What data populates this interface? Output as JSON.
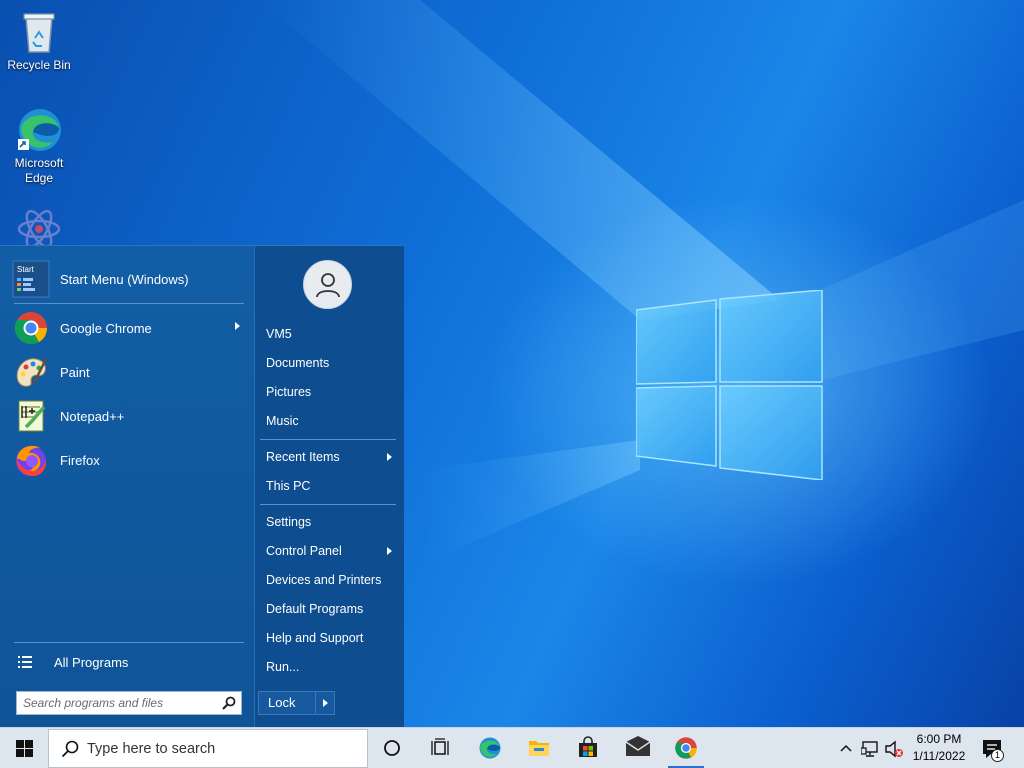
{
  "desktop": {
    "icons": [
      {
        "label": "Recycle Bin",
        "icon": "recycle-bin-icon"
      },
      {
        "label": "Microsoft Edge",
        "icon": "edge-icon"
      },
      {
        "label": "",
        "icon": "partial-app-icon"
      }
    ]
  },
  "start_menu": {
    "programs": [
      {
        "label": "Start Menu (Windows)",
        "icon": "start-menu-icon",
        "icon_text": "Start"
      },
      {
        "label": "Google Chrome",
        "icon": "chrome-icon",
        "has_submenu": true
      },
      {
        "label": "Paint",
        "icon": "paint-icon"
      },
      {
        "label": "Notepad++",
        "icon": "notepad-plus-plus-icon"
      },
      {
        "label": "Firefox",
        "icon": "firefox-icon"
      }
    ],
    "all_programs_label": "All Programs",
    "search_placeholder": "Search programs and files",
    "user_name": "VM5",
    "right_items": [
      {
        "label": "VM5"
      },
      {
        "label": "Documents"
      },
      {
        "label": "Pictures"
      },
      {
        "label": "Music"
      },
      {
        "label": "Recent Items",
        "has_submenu": true
      },
      {
        "label": "This PC"
      },
      {
        "label": "Settings"
      },
      {
        "label": "Control Panel",
        "has_submenu": true
      },
      {
        "label": "Devices and Printers"
      },
      {
        "label": "Default Programs"
      },
      {
        "label": "Help and Support"
      },
      {
        "label": "Run..."
      }
    ],
    "lock_label": "Lock"
  },
  "taskbar": {
    "search_placeholder": "Type here to search",
    "pinned": [
      "cortana-icon",
      "task-view-icon",
      "edge-icon",
      "file-explorer-icon",
      "store-icon",
      "mail-icon",
      "chrome-icon"
    ],
    "time": "6:00 PM",
    "date": "1/11/2022",
    "notification_count": "1"
  },
  "colors": {
    "start_menu_bg": "#0e4f94",
    "taskbar_bg": "#dde5ef",
    "accent": "#2f6fd0"
  }
}
